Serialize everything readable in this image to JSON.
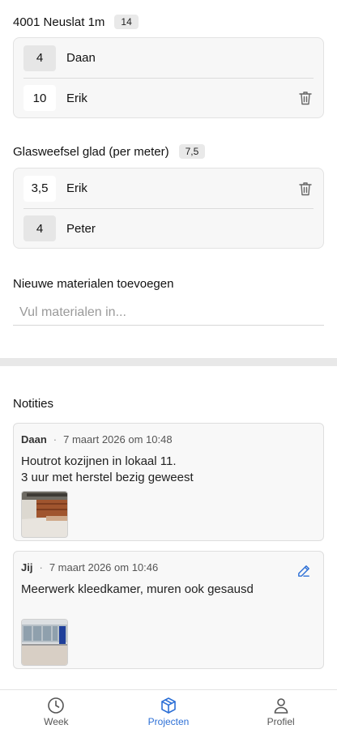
{
  "materials": [
    {
      "title": "4001 Neuslat 1m",
      "total": "14",
      "rows": [
        {
          "qty": "4",
          "name": "Daan",
          "deletable": false
        },
        {
          "qty": "10",
          "name": "Erik",
          "deletable": true
        }
      ]
    },
    {
      "title": "Glasweefsel glad (per meter)",
      "total": "7,5",
      "rows": [
        {
          "qty": "3,5",
          "name": "Erik",
          "deletable": true
        },
        {
          "qty": "4",
          "name": "Peter",
          "deletable": false
        }
      ]
    }
  ],
  "add_materials": {
    "label": "Nieuwe materialen toevoegen",
    "placeholder": "Vul materialen in..."
  },
  "notes": {
    "title": "Notities",
    "items": [
      {
        "author": "Daan",
        "date": "7 maart 2026 om 10:48",
        "lines": [
          "Houtrot kozijnen in lokaal 11.",
          "3 uur met herstel bezig geweest"
        ],
        "editable": false
      },
      {
        "author": "Jij",
        "date": "7 maart 2026 om 10:46",
        "lines": [
          "Meerwerk kleedkamer, muren ook gesausd"
        ],
        "editable": true
      }
    ]
  },
  "tabbar": {
    "tabs": [
      {
        "label": "Week",
        "icon": "clock-icon",
        "active": false
      },
      {
        "label": "Projecten",
        "icon": "box-icon",
        "active": true
      },
      {
        "label": "Profiel",
        "icon": "user-icon",
        "active": false
      }
    ]
  },
  "colors": {
    "accent": "#2c6fd6"
  }
}
